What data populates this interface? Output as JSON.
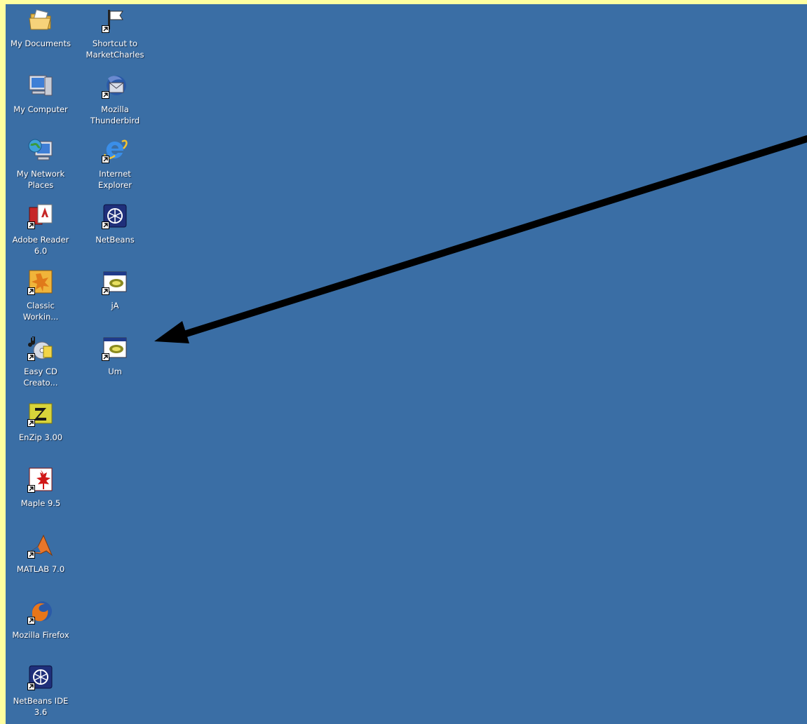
{
  "desktop": {
    "background_color": "#3a6ea5",
    "frame_color": "#ffffa0",
    "icons": [
      {
        "label": "My Documents",
        "icon": "folder-documents-icon",
        "shortcut": false
      },
      {
        "label": "Shortcut to\nMarketCharles",
        "icon": "flag-document-icon",
        "shortcut": true
      },
      {
        "label": "My Computer",
        "icon": "computer-icon",
        "shortcut": false
      },
      {
        "label": "Mozilla\nThunderbird",
        "icon": "thunderbird-icon",
        "shortcut": true
      },
      {
        "label": "My Network\nPlaces",
        "icon": "network-places-icon",
        "shortcut": false
      },
      {
        "label": "Internet\nExplorer",
        "icon": "internet-explorer-icon",
        "shortcut": true
      },
      {
        "label": "Adobe Reader\n6.0",
        "icon": "adobe-reader-icon",
        "shortcut": true
      },
      {
        "label": "NetBeans",
        "icon": "netbeans-icon",
        "shortcut": true
      },
      {
        "label": "Classic\nWorkin...",
        "icon": "classic-workin-icon",
        "shortcut": true
      },
      {
        "label": "jA",
        "icon": "program-window-icon",
        "shortcut": true
      },
      {
        "label": "Easy CD\nCreato...",
        "icon": "easy-cd-creator-icon",
        "shortcut": true
      },
      {
        "label": "Um",
        "icon": "program-window-icon",
        "shortcut": true
      },
      {
        "label": "EnZip 3.00",
        "icon": "enzip-icon",
        "shortcut": true
      },
      {
        "label": "Maple 9.5",
        "icon": "maple-icon",
        "shortcut": true
      },
      {
        "label": "MATLAB 7.0",
        "icon": "matlab-icon",
        "shortcut": true
      },
      {
        "label": "Mozilla Firefox",
        "icon": "firefox-icon",
        "shortcut": true
      },
      {
        "label": "NetBeans IDE\n3.6",
        "icon": "netbeans-icon",
        "shortcut": true
      }
    ]
  },
  "annotation": {
    "arrow_color": "#000000",
    "points_to": "Um"
  }
}
